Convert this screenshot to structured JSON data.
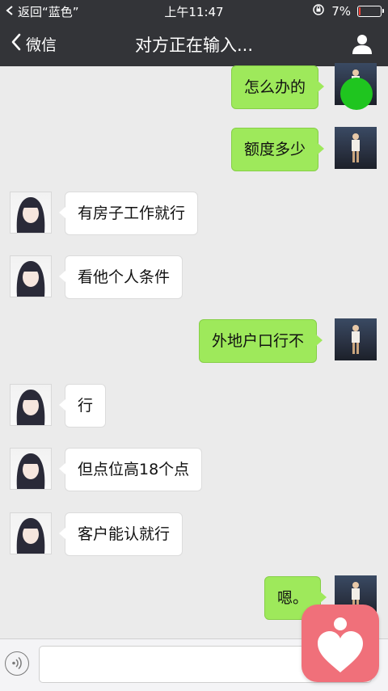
{
  "status_bar": {
    "back_app": "返回“蓝色”",
    "time": "上午11:47",
    "battery_percent": "7%",
    "battery_level": 0.07,
    "icons": [
      "back-arrow-icon",
      "orientation-lock-icon",
      "battery-icon"
    ]
  },
  "nav": {
    "back_label": "微信",
    "title": "对方正在输入...",
    "icons": [
      "chevron-left-icon",
      "profile-icon"
    ]
  },
  "messages": [
    {
      "side": "out",
      "text": "怎么办的"
    },
    {
      "side": "out",
      "text": "额度多少"
    },
    {
      "side": "in",
      "text": "有房子工作就行"
    },
    {
      "side": "in",
      "text": "看他个人条件"
    },
    {
      "side": "out",
      "text": "外地户口行不"
    },
    {
      "side": "in",
      "text": "行"
    },
    {
      "side": "in",
      "text": "但点位高18个点"
    },
    {
      "side": "in",
      "text": "客户能认就行"
    },
    {
      "side": "out",
      "text": "嗯。"
    }
  ],
  "input_bar": {
    "icons": [
      "voice-icon",
      "heart-app-icon"
    ]
  },
  "colors": {
    "bar_bg": "#333438",
    "chat_bg": "#ebebeb",
    "out_bubble": "#9ee95b",
    "in_bubble": "#ffffff",
    "overlay_app": "#f0707a",
    "green_dot": "#1fc51f"
  }
}
